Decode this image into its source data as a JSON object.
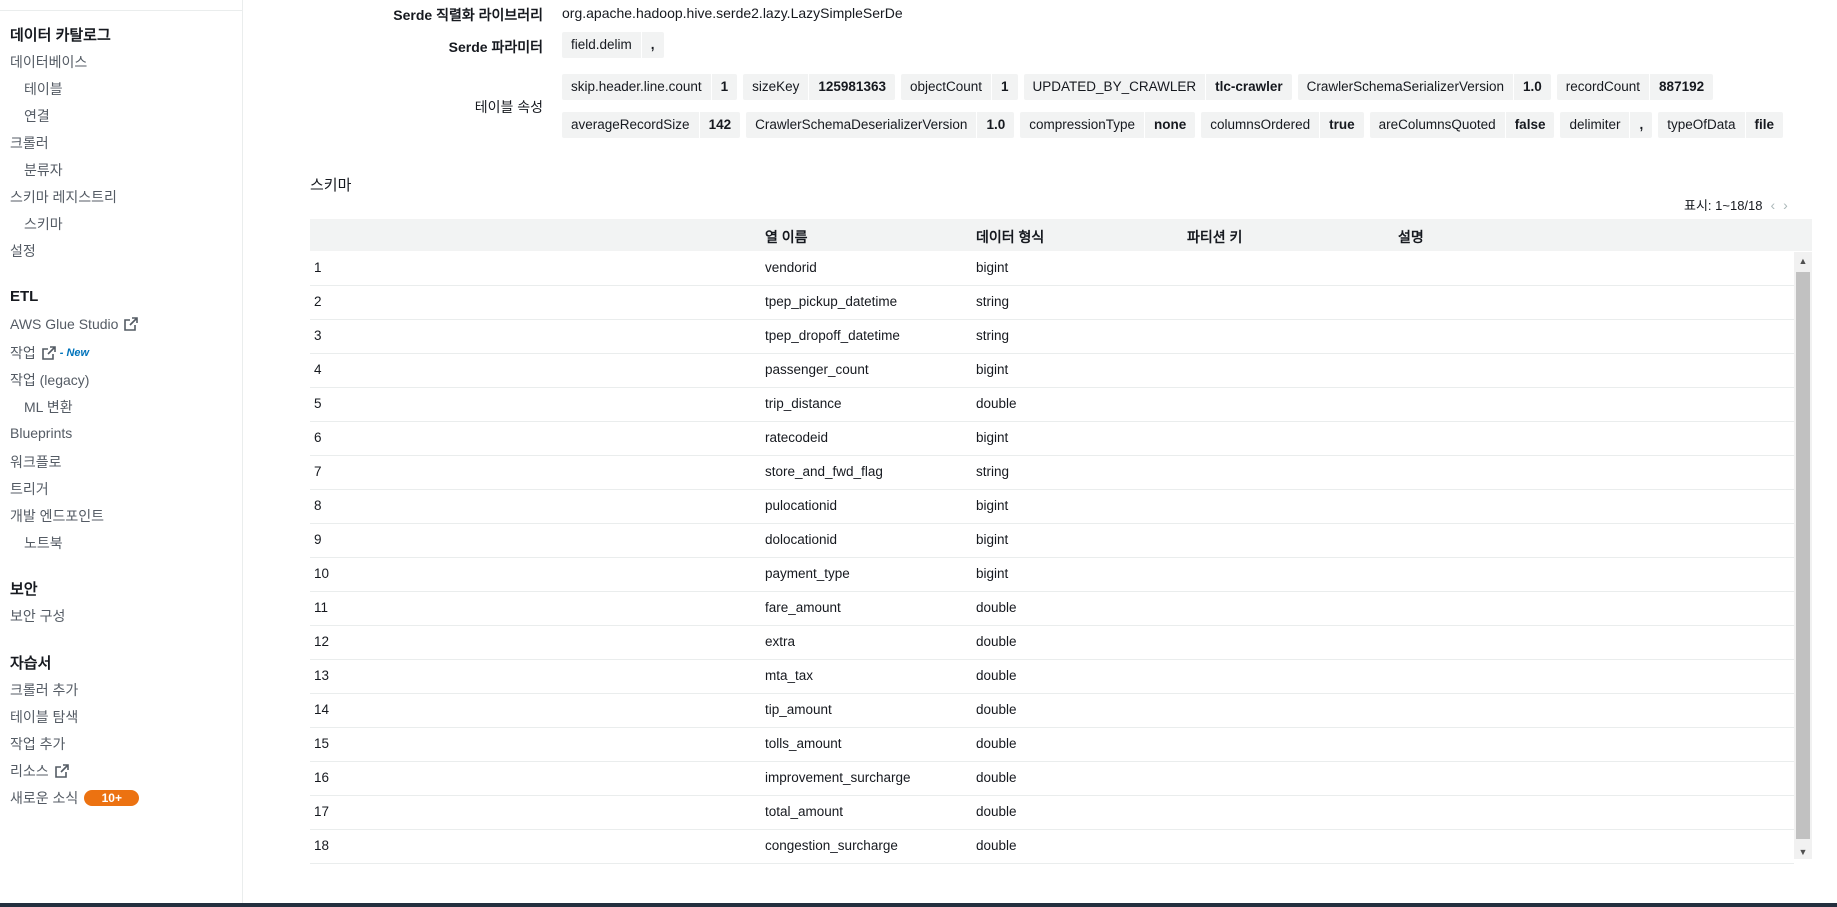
{
  "sidebar": {
    "sections": [
      {
        "title": "데이터 카탈로그",
        "items": [
          {
            "label": "데이터베이스",
            "level": 1
          },
          {
            "label": "테이블",
            "level": 2
          },
          {
            "label": "연결",
            "level": 2
          },
          {
            "label": "크롤러",
            "level": 1
          },
          {
            "label": "분류자",
            "level": 2
          },
          {
            "label": "스키마 레지스트리",
            "level": 1
          },
          {
            "label": "스키마",
            "level": 2
          },
          {
            "label": "설정",
            "level": 1
          }
        ]
      },
      {
        "title": "ETL",
        "items": [
          {
            "label": "AWS Glue Studio",
            "level": 1,
            "external": true
          },
          {
            "label": "작업",
            "level": 1,
            "external": true,
            "new_label": "- New"
          },
          {
            "label": "작업 (legacy)",
            "level": 1
          },
          {
            "label": "ML 변환",
            "level": 2
          },
          {
            "label": "Blueprints",
            "level": 1
          },
          {
            "label": "워크플로",
            "level": 1
          },
          {
            "label": "트리거",
            "level": 1
          },
          {
            "label": "개발 엔드포인트",
            "level": 1
          },
          {
            "label": "노트북",
            "level": 2
          }
        ]
      },
      {
        "title": "보안",
        "items": [
          {
            "label": "보안 구성",
            "level": 1
          }
        ]
      },
      {
        "title": "자습서",
        "items": [
          {
            "label": "크롤러 추가",
            "level": 1
          },
          {
            "label": "테이블 탐색",
            "level": 1
          },
          {
            "label": "작업 추가",
            "level": 1
          },
          {
            "label": "리소스",
            "level": 1,
            "external": true
          },
          {
            "label": "새로운 소식",
            "level": 1,
            "badge": "10+"
          }
        ]
      }
    ]
  },
  "details": {
    "serde_lib_label": "Serde 직렬화 라이브러리",
    "serde_lib_value": "org.apache.hadoop.hive.serde2.lazy.LazySimpleSerDe",
    "serde_params_label": "Serde 파라미터",
    "serde_params": [
      {
        "k": "field.delim",
        "v": ","
      }
    ],
    "table_props_label": "테이블 속성",
    "table_props_row1": [
      {
        "k": "skip.header.line.count",
        "v": "1"
      },
      {
        "k": "sizeKey",
        "v": "125981363"
      },
      {
        "k": "objectCount",
        "v": "1"
      },
      {
        "k": "UPDATED_BY_CRAWLER",
        "v": "tlc-crawler"
      },
      {
        "k": "CrawlerSchemaSerializerVersion",
        "v": "1.0"
      },
      {
        "k": "recordCount",
        "v": "887192"
      }
    ],
    "table_props_row2": [
      {
        "k": "averageRecordSize",
        "v": "142"
      },
      {
        "k": "CrawlerSchemaDeserializerVersion",
        "v": "1.0"
      },
      {
        "k": "compressionType",
        "v": "none"
      },
      {
        "k": "columnsOrdered",
        "v": "true"
      },
      {
        "k": "areColumnsQuoted",
        "v": "false"
      },
      {
        "k": "delimiter",
        "v": ","
      },
      {
        "k": "typeOfData",
        "v": "file"
      }
    ]
  },
  "schema": {
    "title": "스키마",
    "pager_text": "표시: 1~18/18",
    "columns": [
      "열 이름",
      "데이터 형식",
      "파티션 키",
      "설명"
    ],
    "rows": [
      {
        "n": "1",
        "name": "vendorid",
        "type": "bigint"
      },
      {
        "n": "2",
        "name": "tpep_pickup_datetime",
        "type": "string"
      },
      {
        "n": "3",
        "name": "tpep_dropoff_datetime",
        "type": "string"
      },
      {
        "n": "4",
        "name": "passenger_count",
        "type": "bigint"
      },
      {
        "n": "5",
        "name": "trip_distance",
        "type": "double"
      },
      {
        "n": "6",
        "name": "ratecodeid",
        "type": "bigint"
      },
      {
        "n": "7",
        "name": "store_and_fwd_flag",
        "type": "string"
      },
      {
        "n": "8",
        "name": "pulocationid",
        "type": "bigint"
      },
      {
        "n": "9",
        "name": "dolocationid",
        "type": "bigint"
      },
      {
        "n": "10",
        "name": "payment_type",
        "type": "bigint"
      },
      {
        "n": "11",
        "name": "fare_amount",
        "type": "double"
      },
      {
        "n": "12",
        "name": "extra",
        "type": "double"
      },
      {
        "n": "13",
        "name": "mta_tax",
        "type": "double"
      },
      {
        "n": "14",
        "name": "tip_amount",
        "type": "double"
      },
      {
        "n": "15",
        "name": "tolls_amount",
        "type": "double"
      },
      {
        "n": "16",
        "name": "improvement_surcharge",
        "type": "double"
      },
      {
        "n": "17",
        "name": "total_amount",
        "type": "double"
      },
      {
        "n": "18",
        "name": "congestion_surcharge",
        "type": "double"
      }
    ]
  }
}
